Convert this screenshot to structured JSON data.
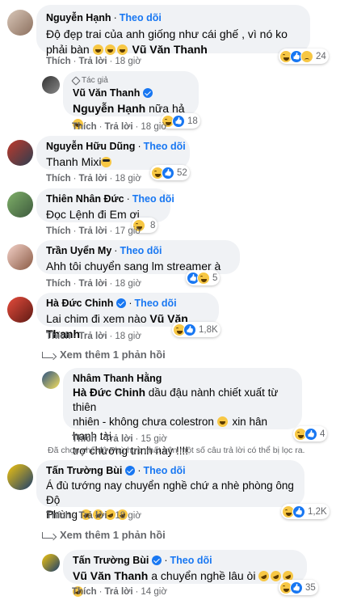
{
  "follow_label": "Theo dõi",
  "like_label": "Thích",
  "reply_label": "Trả lời",
  "author_tag": "Tác giả",
  "comments": [
    {
      "name": "Nguyễn Hạnh",
      "text_before": "Độ đẹp trai của anh giống như cái ghế , vì nó ko phải bàn",
      "mention": "Vũ Văn Thanh",
      "time": "18 giờ",
      "reaction_count": "24"
    },
    {
      "name": "Vũ Văn Thanh",
      "mention": "Nguyễn Hạnh",
      "text_after": "nữa hả",
      "time": "18 giờ",
      "reaction_count": "18"
    },
    {
      "name": "Nguyễn Hữu Dũng",
      "text": "Thanh Mixi",
      "time": "18 giờ",
      "reaction_count": "52"
    },
    {
      "name": "Thiên Nhân Đức",
      "text": "Đọc Lệnh đi Em ơi",
      "time": "17 giờ",
      "reaction_count": "8"
    },
    {
      "name": "Trần Uyển My",
      "text": "Ahh tôi chuyển sang lm streamer à",
      "time": "18 giờ",
      "reaction_count": "5"
    },
    {
      "name": "Hà Đức Chinh",
      "text": "Lai chim đi xem nào",
      "mention": "Vũ Văn Thanh",
      "time": "18 giờ",
      "reaction_count": "1,8K"
    },
    {
      "name": "Nhâm Thanh Hằng",
      "mention": "Hà Đức Chinh",
      "text_line1": "dầu đậu nành chiết xuất từ thiên",
      "text_line2": "nhiên - không chưa colestron",
      "text_line2b": "xin hân hạnh tài",
      "text_line3": "trợ chương trình này !!!!",
      "time": "15 giờ",
      "reaction_count": "4"
    },
    {
      "name": "Tấn Trường Bùi",
      "text_line1": "Á đù tướng nay chuyển nghề chứ a nhè phòng ông Độ",
      "text_line2": "Phùng",
      "time": "18 giờ",
      "reaction_count": "1,2K"
    },
    {
      "name": "Tấn Trường Bùi",
      "mention": "Vũ Văn Thanh",
      "text_after": "a chuyển nghề lâu òi",
      "time": "14 giờ",
      "reaction_count": "35"
    }
  ],
  "more_replies_label": "Xem thêm 1 phản hồi",
  "filter_note": "Đã chọn chế độ Phù hợp nhất nên một số câu trả lời có thể bị lọc ra.",
  "colors": {
    "link": "#1877f2",
    "bubble": "#f0f2f5",
    "muted": "#65676b"
  }
}
